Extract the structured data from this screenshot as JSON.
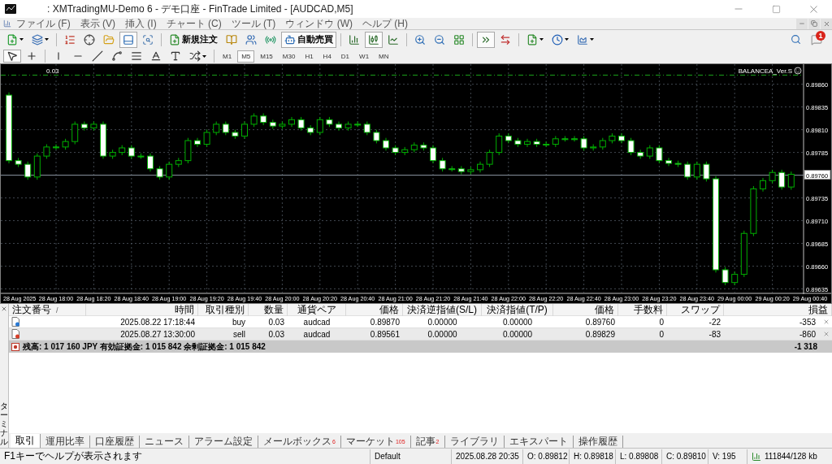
{
  "window": {
    "title": ": XMTradingMU-Demo 6 - デモ口座 - FinTrade Limited - [AUDCAD,M5]"
  },
  "menu": [
    "ファイル (F)",
    "表示 (V)",
    "挿入 (I)",
    "チャート (C)",
    "ツール (T)",
    "ウィンドウ (W)",
    "ヘルプ (H)"
  ],
  "toolbar": [
    {
      "kind": "dropdown",
      "pressed": false
    },
    {
      "kind": "dropdown",
      "pressed": false
    },
    {
      "kind": "separator"
    },
    {
      "kind": "icon",
      "pressed": false
    },
    {
      "kind": "icon",
      "pressed": false
    },
    {
      "kind": "icon",
      "pressed": false
    },
    {
      "kind": "icon",
      "pressed": true
    },
    {
      "kind": "icon",
      "pressed": false
    },
    {
      "kind": "separator"
    },
    {
      "kind": "text",
      "label": "新規注文",
      "pressed": false
    },
    {
      "kind": "icon",
      "pressed": false
    },
    {
      "kind": "icon",
      "pressed": false
    },
    {
      "kind": "icon",
      "pressed": false
    },
    {
      "kind": "text",
      "label": "自動売買",
      "pressed": true
    },
    {
      "kind": "separator"
    },
    {
      "kind": "icon",
      "pressed": false
    },
    {
      "kind": "icon",
      "pressed": true
    },
    {
      "kind": "icon",
      "pressed": false
    },
    {
      "kind": "separator"
    },
    {
      "kind": "icon",
      "pressed": false
    },
    {
      "kind": "icon",
      "pressed": false
    },
    {
      "kind": "icon",
      "pressed": false
    },
    {
      "kind": "separator"
    },
    {
      "kind": "icon",
      "pressed": true
    },
    {
      "kind": "icon",
      "pressed": false
    },
    {
      "kind": "separator"
    },
    {
      "kind": "dropdown",
      "pressed": false
    },
    {
      "kind": "dropdown",
      "pressed": false
    },
    {
      "kind": "dropdown",
      "pressed": false
    }
  ],
  "notifications": {
    "badge": "1"
  },
  "drawing_toolbar": [
    {
      "kind": "icon",
      "pressed": true
    },
    {
      "kind": "icon",
      "pressed": false
    },
    {
      "kind": "separator"
    },
    {
      "kind": "icon",
      "pressed": false
    },
    {
      "kind": "icon",
      "pressed": false
    },
    {
      "kind": "icon",
      "pressed": false
    },
    {
      "kind": "icon",
      "pressed": false
    },
    {
      "kind": "icon",
      "pressed": false
    },
    {
      "kind": "icon",
      "pressed": false
    },
    {
      "kind": "icon",
      "pressed": false
    },
    {
      "kind": "dropdown",
      "pressed": false
    },
    {
      "kind": "separator"
    }
  ],
  "timeframes": [
    {
      "label": "M1",
      "selected": false
    },
    {
      "label": "M5",
      "selected": true
    },
    {
      "label": "M15",
      "selected": false
    },
    {
      "label": "M30",
      "selected": false
    },
    {
      "label": "H1",
      "selected": false
    },
    {
      "label": "H4",
      "selected": false
    },
    {
      "label": "D1",
      "selected": false
    },
    {
      "label": "W1",
      "selected": false
    },
    {
      "label": "MN",
      "selected": false
    }
  ],
  "chart": {
    "info": "0.03",
    "expert": "BALANCEA_Ver.S",
    "start_date": "28 Aug 2025",
    "chart_data": {
      "type": "candlestick",
      "ylim": [
        0.89631,
        0.89882
      ],
      "categories": [
        null,
        null,
        null,
        null,
        null,
        "28 Aug 18:00",
        null,
        null,
        null,
        "28 Aug 18:20",
        null,
        null,
        null,
        "28 Aug 18:40",
        null,
        null,
        null,
        "28 Aug 19:00",
        null,
        null,
        null,
        "28 Aug 19:20",
        null,
        null,
        null,
        "28 Aug 19:40",
        null,
        null,
        null,
        "28 Aug 20:00",
        null,
        null,
        null,
        "28 Aug 20:20",
        null,
        null,
        null,
        "28 Aug 20:40",
        null,
        null,
        null,
        "28 Aug 21:00",
        null,
        null,
        null,
        "28 Aug 21:20",
        null,
        null,
        null,
        "28 Aug 21:40",
        null,
        null,
        null,
        "28 Aug 22:00",
        null,
        null,
        null,
        "28 Aug 22:20",
        null,
        null,
        null,
        "28 Aug 22:40",
        null,
        null,
        null,
        "28 Aug 23:00",
        null,
        null,
        null,
        "28 Aug 23:20",
        null,
        null,
        null,
        "28 Aug 23:40",
        null,
        null,
        null,
        "29 Aug 00:00",
        null,
        null,
        null,
        "29 Aug 00:20",
        null,
        null,
        null,
        "29 Aug 00:40"
      ],
      "yticks": [
        {
          "value": 0.8986,
          "label": "0.89860"
        },
        {
          "value": 0.89835,
          "label": "0.89835"
        },
        {
          "value": 0.8981,
          "label": "0.89810"
        },
        {
          "value": 0.89785,
          "label": "0.89785"
        },
        {
          "value": 0.89735,
          "label": "0.89735"
        },
        {
          "value": 0.8971,
          "label": "0.89710"
        },
        {
          "value": 0.89685,
          "label": "0.89685"
        },
        {
          "value": 0.8966,
          "label": "0.89660"
        },
        {
          "value": 0.89635,
          "label": "0.89635"
        }
      ],
      "grid": true,
      "ref_lines": [
        {
          "axis": "y",
          "value": 0.8976,
          "label": "0.89760",
          "color": "#8a94a0"
        },
        {
          "axis": "y",
          "value": 0.8987,
          "color": "#1aa31a"
        }
      ],
      "ohlc": [
        [
          0.89848,
          0.89851,
          0.89773,
          0.89776
        ],
        [
          0.89776,
          0.89779,
          0.89769,
          0.89772
        ],
        [
          0.89772,
          0.89775,
          0.89755,
          0.89758
        ],
        [
          0.89758,
          0.89784,
          0.89755,
          0.89781
        ],
        [
          0.89781,
          0.89794,
          0.89778,
          0.89791
        ],
        [
          0.89791,
          0.89794,
          0.89788,
          0.89791
        ],
        [
          0.89791,
          0.898,
          0.89788,
          0.89797
        ],
        [
          0.89797,
          0.89819,
          0.89794,
          0.89816
        ],
        [
          0.89816,
          0.89819,
          0.89809,
          0.89812
        ],
        [
          0.89812,
          0.89819,
          0.89809,
          0.89816
        ],
        [
          0.89816,
          0.89819,
          0.89778,
          0.89781
        ],
        [
          0.89781,
          0.89788,
          0.89778,
          0.89785
        ],
        [
          0.89785,
          0.89793,
          0.89782,
          0.8979
        ],
        [
          0.8979,
          0.89793,
          0.89778,
          0.89781
        ],
        [
          0.89781,
          0.89784,
          0.89778,
          0.89781
        ],
        [
          0.89781,
          0.89784,
          0.89764,
          0.89767
        ],
        [
          0.89767,
          0.8977,
          0.89755,
          0.89758
        ],
        [
          0.89758,
          0.89775,
          0.89755,
          0.89772
        ],
        [
          0.89772,
          0.89779,
          0.89769,
          0.89776
        ],
        [
          0.89776,
          0.89801,
          0.89773,
          0.89798
        ],
        [
          0.89798,
          0.89801,
          0.89791,
          0.89794
        ],
        [
          0.89794,
          0.8981,
          0.89791,
          0.89807
        ],
        [
          0.89807,
          0.89819,
          0.89804,
          0.89816
        ],
        [
          0.89816,
          0.89819,
          0.89804,
          0.89807
        ],
        [
          0.89807,
          0.8981,
          0.898,
          0.89803
        ],
        [
          0.89803,
          0.89819,
          0.898,
          0.89816
        ],
        [
          0.89816,
          0.89828,
          0.89813,
          0.89825
        ],
        [
          0.89825,
          0.89828,
          0.89815,
          0.89818
        ],
        [
          0.89818,
          0.89821,
          0.89811,
          0.89814
        ],
        [
          0.89814,
          0.89819,
          0.89811,
          0.89816
        ],
        [
          0.89816,
          0.89824,
          0.89813,
          0.89821
        ],
        [
          0.89821,
          0.89824,
          0.89809,
          0.89812
        ],
        [
          0.89812,
          0.89815,
          0.89804,
          0.89807
        ],
        [
          0.89807,
          0.89824,
          0.89804,
          0.89821
        ],
        [
          0.89821,
          0.89824,
          0.89813,
          0.89816
        ],
        [
          0.89816,
          0.89819,
          0.89809,
          0.89812
        ],
        [
          0.89812,
          0.89819,
          0.89809,
          0.89816
        ],
        [
          0.89816,
          0.89819,
          0.89813,
          0.89816
        ],
        [
          0.89816,
          0.89819,
          0.89804,
          0.89807
        ],
        [
          0.89807,
          0.8981,
          0.89795,
          0.89798
        ],
        [
          0.89798,
          0.89801,
          0.89787,
          0.8979
        ],
        [
          0.8979,
          0.89793,
          0.89782,
          0.89785
        ],
        [
          0.89785,
          0.89791,
          0.89782,
          0.89788
        ],
        [
          0.89788,
          0.89796,
          0.89785,
          0.89793
        ],
        [
          0.89793,
          0.89796,
          0.89787,
          0.8979
        ],
        [
          0.8979,
          0.89793,
          0.89773,
          0.89776
        ],
        [
          0.89776,
          0.89779,
          0.89764,
          0.89767
        ],
        [
          0.89767,
          0.8977,
          0.89764,
          0.89767
        ],
        [
          0.89767,
          0.8977,
          0.89761,
          0.89764
        ],
        [
          0.89764,
          0.89769,
          0.89761,
          0.89766
        ],
        [
          0.89766,
          0.89775,
          0.89763,
          0.89772
        ],
        [
          0.89772,
          0.89788,
          0.89769,
          0.89785
        ],
        [
          0.89785,
          0.89806,
          0.89782,
          0.89803
        ],
        [
          0.89803,
          0.89806,
          0.89795,
          0.89798
        ],
        [
          0.89798,
          0.89801,
          0.89791,
          0.89794
        ],
        [
          0.89794,
          0.898,
          0.89791,
          0.89797
        ],
        [
          0.89797,
          0.898,
          0.89791,
          0.89794
        ],
        [
          0.89794,
          0.89797,
          0.89791,
          0.89794
        ],
        [
          0.89794,
          0.89803,
          0.89791,
          0.898
        ],
        [
          0.898,
          0.89803,
          0.89797,
          0.898
        ],
        [
          0.898,
          0.89803,
          0.89797,
          0.898
        ],
        [
          0.898,
          0.89803,
          0.89787,
          0.8979
        ],
        [
          0.8979,
          0.89794,
          0.89787,
          0.89791
        ],
        [
          0.89791,
          0.89801,
          0.89788,
          0.89798
        ],
        [
          0.89798,
          0.89806,
          0.89795,
          0.89803
        ],
        [
          0.89803,
          0.89806,
          0.89795,
          0.89798
        ],
        [
          0.89798,
          0.89801,
          0.89782,
          0.89785
        ],
        [
          0.89785,
          0.89788,
          0.89778,
          0.89781
        ],
        [
          0.89781,
          0.89793,
          0.89778,
          0.8979
        ],
        [
          0.8979,
          0.89793,
          0.89773,
          0.89776
        ],
        [
          0.89776,
          0.89779,
          0.8977,
          0.89773
        ],
        [
          0.89773,
          0.89776,
          0.89769,
          0.89772
        ],
        [
          0.89772,
          0.89775,
          0.89755,
          0.89758
        ],
        [
          0.89758,
          0.89775,
          0.89755,
          0.89772
        ],
        [
          0.89772,
          0.89775,
          0.89753,
          0.89756
        ],
        [
          0.89756,
          0.89759,
          0.89653,
          0.89656
        ],
        [
          0.89656,
          0.89659,
          0.89639,
          0.89642
        ],
        [
          0.89642,
          0.89654,
          0.89639,
          0.89651
        ],
        [
          0.89651,
          0.89699,
          0.89648,
          0.89696
        ],
        [
          0.89696,
          0.89748,
          0.89693,
          0.89745
        ],
        [
          0.89745,
          0.89757,
          0.89742,
          0.89754
        ],
        [
          0.89754,
          0.89766,
          0.89751,
          0.89763
        ],
        [
          0.89763,
          0.89766,
          0.89744,
          0.89747
        ],
        [
          0.89747,
          0.89764,
          0.89744,
          0.89761
        ],
        null,
        null
      ]
    }
  },
  "terminal": {
    "side_label": "ターミナル",
    "columns": [
      {
        "label": "注文番号",
        "sort_mark": "/"
      },
      {
        "label": "時間"
      },
      {
        "label": "取引種別"
      },
      {
        "label": "数量"
      },
      {
        "label": "通貨ペア"
      },
      {
        "label": "価格"
      },
      {
        "label": "決済逆指値(S/L)"
      },
      {
        "label": "決済指値(T/P)"
      },
      {
        "label": "価格"
      },
      {
        "label": "手数料"
      },
      {
        "label": "スワップ"
      },
      {
        "label": "損益"
      }
    ],
    "rows": [
      {
        "kind": "buy",
        "cells": [
          "",
          "2025.08.22 17:18:44",
          "buy",
          "0.03",
          "audcad",
          "0.89870",
          "0.00000",
          "0.00000",
          "0.89760",
          "0",
          "-22",
          "-353"
        ]
      },
      {
        "kind": "sell",
        "cells": [
          "",
          "2025.08.27 13:30:00",
          "sell",
          "0.03",
          "audcad",
          "0.89561",
          "0.00000",
          "0.00000",
          "0.89829",
          "0",
          "-83",
          "-860"
        ]
      }
    ],
    "summary": {
      "text": "残高: 1 017 160 JPY  有効証拠金: 1 015 842  余剰証拠金: 1 015 842",
      "total": "-1 318"
    },
    "tabs": [
      {
        "label": "取引",
        "selected": true
      },
      {
        "label": "運用比率",
        "selected": false
      },
      {
        "label": "口座履歴",
        "selected": false
      },
      {
        "label": "ニュース",
        "selected": false
      },
      {
        "label": "アラーム設定",
        "selected": false
      },
      {
        "label": "メールボックス",
        "count": "6",
        "selected": false
      },
      {
        "label": "マーケット",
        "count": "105",
        "selected": false
      },
      {
        "label": "記事",
        "count": "2",
        "selected": false
      },
      {
        "label": "ライブラリ",
        "selected": false
      },
      {
        "label": "エキスパート",
        "selected": false
      },
      {
        "label": "操作履歴",
        "selected": false
      }
    ]
  },
  "status_bar": {
    "help": "F1キーでヘルプが表示されます",
    "profile": "Default",
    "time": "2025.08.28 20:35",
    "open": "O: 0.89812",
    "high": "H: 0.89818",
    "low": "L: 0.89808",
    "close": "C: 0.89810",
    "volume": "V: 195",
    "traffic": "111844/128 kb"
  }
}
